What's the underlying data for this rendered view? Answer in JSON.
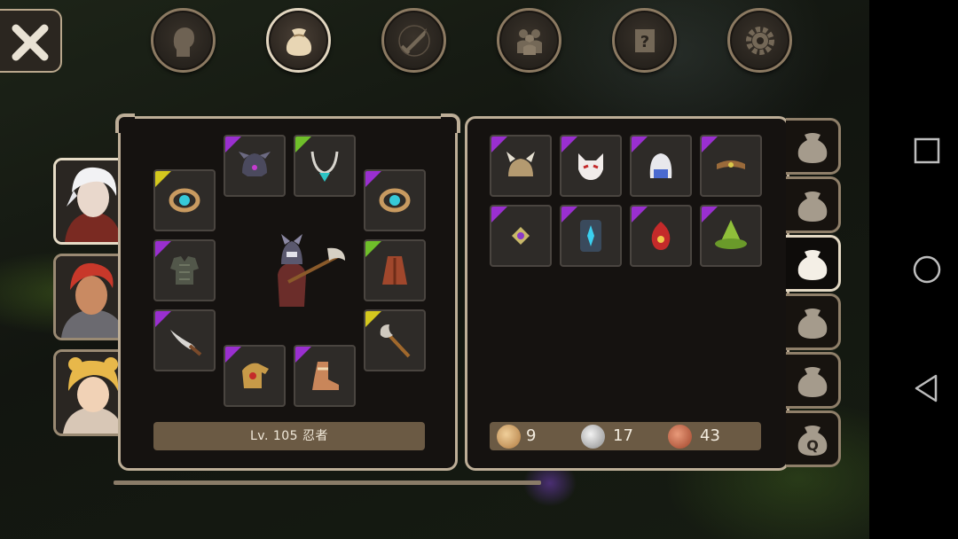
{
  "top_tabs": [
    {
      "icon": "character-head-icon"
    },
    {
      "icon": "bag-icon",
      "active": true
    },
    {
      "icon": "skills-sword-icon"
    },
    {
      "icon": "party-icon"
    },
    {
      "icon": "quest-scroll-icon"
    },
    {
      "icon": "settings-gear-icon"
    }
  ],
  "party": [
    {
      "name": "white-haired-ninja",
      "active": true
    },
    {
      "name": "red-haired-warrior",
      "active": false
    },
    {
      "name": "blonde-mage",
      "active": false
    }
  ],
  "character": {
    "level_class": "Lv. 105 忍者"
  },
  "equipment": [
    {
      "slot": "necklace",
      "rarity": "uncommon"
    },
    {
      "slot": "helmet",
      "rarity": "epic"
    },
    {
      "slot": "ring-left",
      "rarity": "legendary"
    },
    {
      "slot": "ring-right",
      "rarity": "epic"
    },
    {
      "slot": "armor",
      "rarity": "epic"
    },
    {
      "slot": "cloak",
      "rarity": "uncommon"
    },
    {
      "slot": "offhand-sword",
      "rarity": "epic"
    },
    {
      "slot": "weapon-axe",
      "rarity": "legendary"
    },
    {
      "slot": "gloves",
      "rarity": "epic"
    },
    {
      "slot": "boots",
      "rarity": "epic"
    }
  ],
  "inventory": [
    {
      "item": "horned-helmet",
      "rarity": "epic"
    },
    {
      "item": "fox-mask",
      "rarity": "epic"
    },
    {
      "item": "white-hood",
      "rarity": "epic"
    },
    {
      "item": "headband",
      "rarity": "epic"
    },
    {
      "item": "gem-ring",
      "rarity": "epic"
    },
    {
      "item": "blue-shield",
      "rarity": "epic"
    },
    {
      "item": "red-amulet",
      "rarity": "epic"
    },
    {
      "item": "green-hat",
      "rarity": "epic"
    }
  ],
  "currency": {
    "gold": "9",
    "silver": "17",
    "copper": "43"
  },
  "bag_tabs": [
    {
      "label": ""
    },
    {
      "label": ""
    },
    {
      "label": "",
      "active": true
    },
    {
      "label": ""
    },
    {
      "label": ""
    },
    {
      "label": "Q"
    }
  ],
  "colors": {
    "epic": "#9a2fd0",
    "uncommon": "#6fbf2a",
    "legendary": "#d4c81e",
    "frame": "#bdae97",
    "bar": "#6b5a44"
  }
}
